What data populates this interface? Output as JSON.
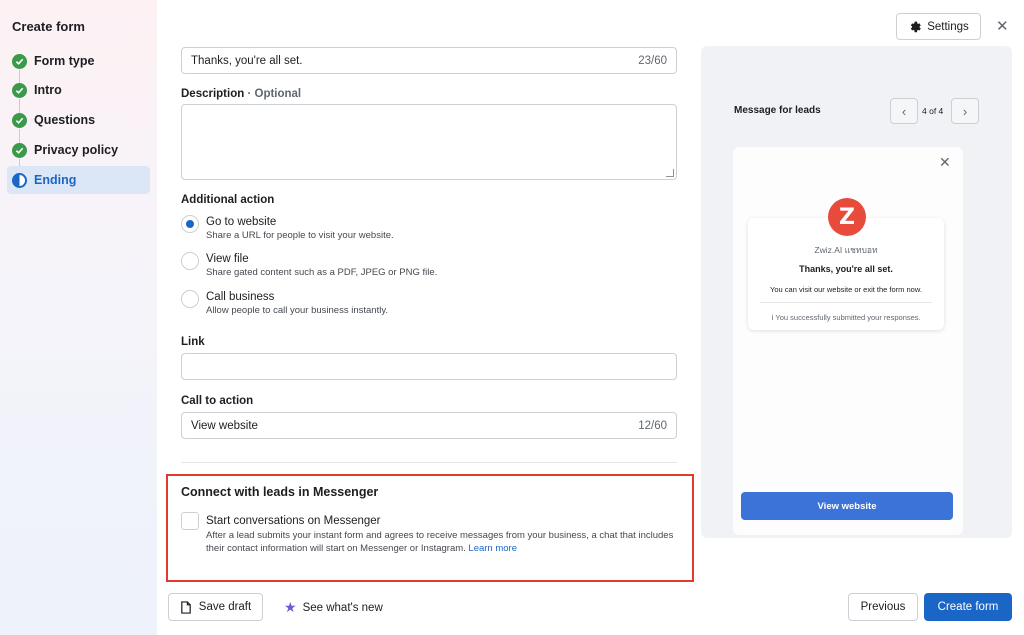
{
  "sidebar": {
    "title": "Create form",
    "steps": [
      {
        "label": "Form type",
        "state": "done"
      },
      {
        "label": "Intro",
        "state": "done"
      },
      {
        "label": "Questions",
        "state": "done"
      },
      {
        "label": "Privacy policy",
        "state": "done"
      },
      {
        "label": "Ending",
        "state": "active"
      }
    ]
  },
  "form": {
    "headline_value": "Thanks, you're all set.",
    "headline_count": "23/60",
    "description_label": "Description",
    "description_optional": "· Optional",
    "description_value": "",
    "additional_action_label": "Additional action",
    "actions": [
      {
        "title": "Go to website",
        "desc": "Share a URL for people to visit your website.",
        "checked": true
      },
      {
        "title": "View file",
        "desc": "Share gated content such as a PDF, JPEG or PNG file.",
        "checked": false
      },
      {
        "title": "Call business",
        "desc": "Allow people to call your business instantly.",
        "checked": false
      }
    ],
    "link_label": "Link",
    "link_value": "",
    "cta_label": "Call to action",
    "cta_value": "View website",
    "cta_count": "12/60",
    "messenger_title": "Connect with leads in Messenger",
    "messenger_checkbox_label": "Start conversations on Messenger",
    "messenger_desc": "After a lead submits your instant form and agrees to receive messages from your business, a chat that includes their contact information will start on Messenger or Instagram.",
    "messenger_link": "Learn more"
  },
  "preview": {
    "label": "Message for leads",
    "pager": "4 of 4",
    "avatar_letter": "Z",
    "business_name": "Zwiz.AI แชทบอท",
    "heading": "Thanks, you're all set.",
    "text": "You can visit our website or exit the form now.",
    "note": "You successfully submitted your responses.",
    "button": "View website"
  },
  "header": {
    "settings_label": "Settings"
  },
  "footer": {
    "save_draft": "Save draft",
    "whats_new": "See what's new",
    "previous": "Previous",
    "create_form": "Create form"
  },
  "colors": {
    "accent": "#1a66c7",
    "check_green": "#3a9a4a",
    "highlight_red": "#e23b2e"
  }
}
